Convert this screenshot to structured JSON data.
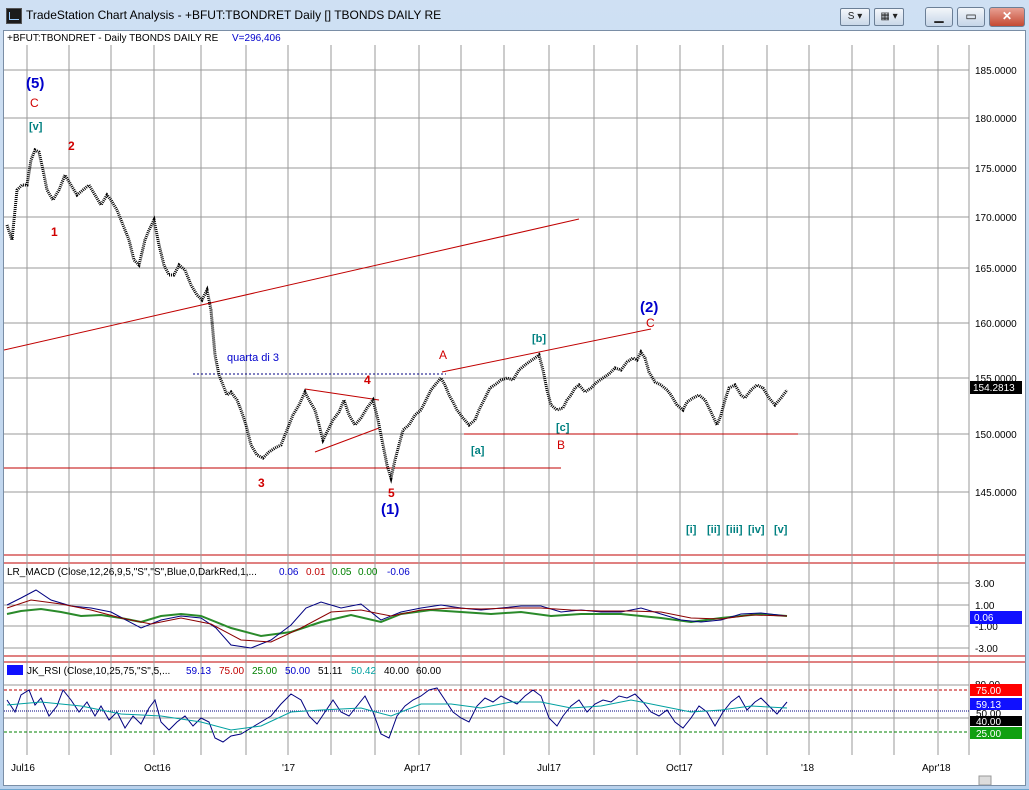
{
  "window": {
    "title": "TradeStation Chart Analysis - +BFUT:TBONDRET Daily [] TBONDS DAILY RE",
    "btn_s": "S",
    "btn_link": "",
    "minimize": "▁",
    "maximize": "▭",
    "close": "✕"
  },
  "price_pane": {
    "symbol_label": "+BFUT:TBONDRET - Daily  TBONDS DAILY RE",
    "volume_label": "V=296,406",
    "current_price": "154.2813",
    "axis": [
      "185.0000",
      "180.0000",
      "175.0000",
      "170.0000",
      "165.0000",
      "160.0000",
      "155.0000",
      "150.0000",
      "145.0000"
    ],
    "annotations": [
      {
        "text": "(5)"
      },
      {
        "text": "C"
      },
      {
        "text": "[v]"
      },
      {
        "text": "2"
      },
      {
        "text": "1"
      },
      {
        "text": "quarta di 3"
      },
      {
        "text": "4"
      },
      {
        "text": "3"
      },
      {
        "text": "5"
      },
      {
        "text": "(1)"
      },
      {
        "text": "A"
      },
      {
        "text": "[a]"
      },
      {
        "text": "[b]"
      },
      {
        "text": "[c]"
      },
      {
        "text": "B"
      },
      {
        "text": "(2)"
      },
      {
        "text": "C"
      },
      {
        "text": "[i]"
      },
      {
        "text": "[ii]"
      },
      {
        "text": "[iii]"
      },
      {
        "text": "[iv]"
      },
      {
        "text": "[v]"
      }
    ]
  },
  "macd_pane": {
    "label": "LR_MACD (Close,12,26,9,5,\"S\",\"S\",Blue,0,DarkRed,1,...",
    "values": [
      "0.06",
      "0.01",
      "0.05",
      "0.00",
      "-0.06"
    ],
    "axis": [
      "3.00",
      "1.00",
      "-1.00",
      "-3.00"
    ],
    "current": "0.06"
  },
  "rsi_pane": {
    "label": "JK_RSI (Close,10,25,75,\"S\",5,...",
    "values": [
      "59.13",
      "75.00",
      "25.00",
      "50.00",
      "51.11",
      "50.42",
      "40.00",
      "60.00"
    ],
    "axis": [
      "80.00"
    ],
    "badges": [
      "75.00",
      "59.13",
      "50.00",
      "40.00",
      "25.00"
    ]
  },
  "time_axis": [
    "Jul16",
    "Oct16",
    "'17",
    "Apr17",
    "Jul17",
    "Oct17",
    "'18",
    "Apr'18"
  ]
}
